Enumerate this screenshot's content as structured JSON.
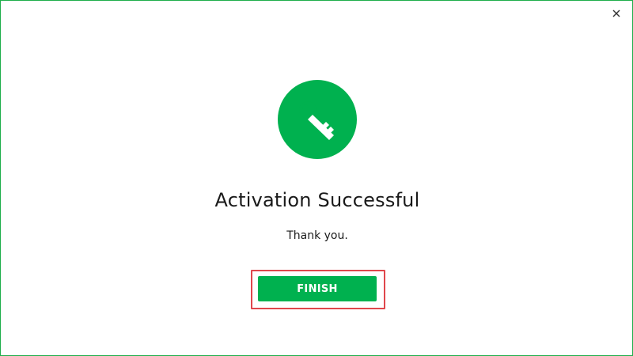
{
  "window": {
    "close_icon": "close-icon",
    "accent_color": "#00b14f",
    "border_color": "#1fae4b"
  },
  "content": {
    "icon": "key-icon",
    "title": "Activation Successful",
    "message": "Thank you."
  },
  "actions": {
    "finish_label": "FINISH",
    "highlight_color": "#e0474c"
  }
}
